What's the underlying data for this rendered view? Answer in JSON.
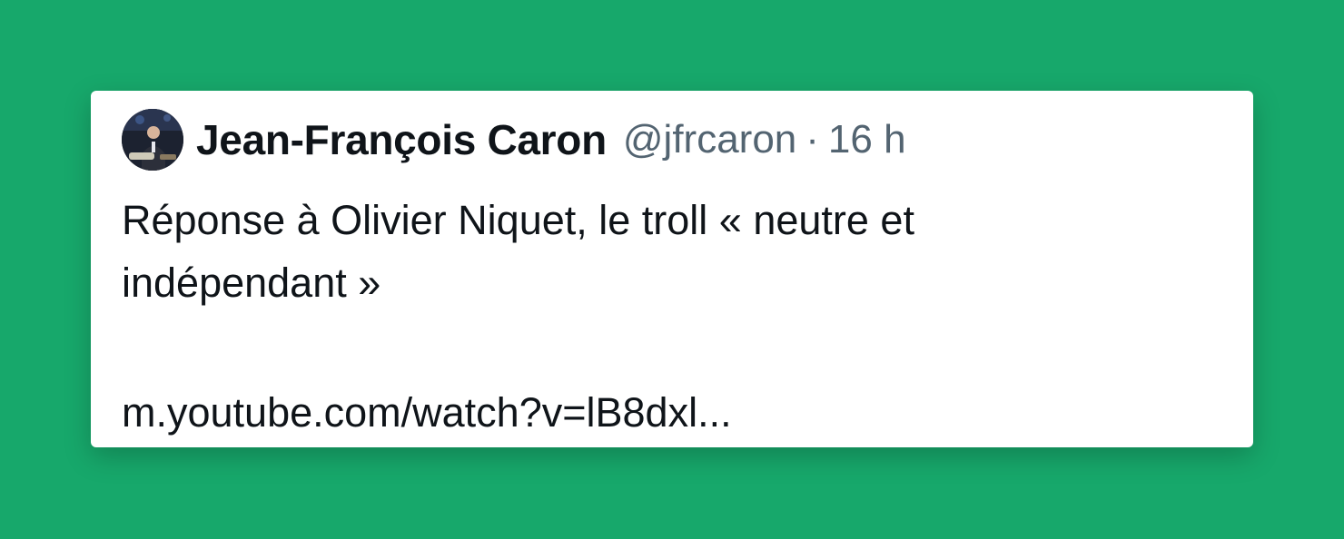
{
  "colors": {
    "background": "#17a86b",
    "card": "#ffffff",
    "text_primary": "#0f1419",
    "text_secondary": "#536471"
  },
  "tweet": {
    "avatar_icon": "profile-photo",
    "author_name": "Jean-François Caron",
    "handle": "@jfrcaron",
    "separator": "·",
    "time": "16 h",
    "text_lines": [
      "Réponse à Olivier Niquet, le troll « neutre et",
      "indépendant »"
    ],
    "link": "m.youtube.com/watch?v=lB8dxl..."
  }
}
